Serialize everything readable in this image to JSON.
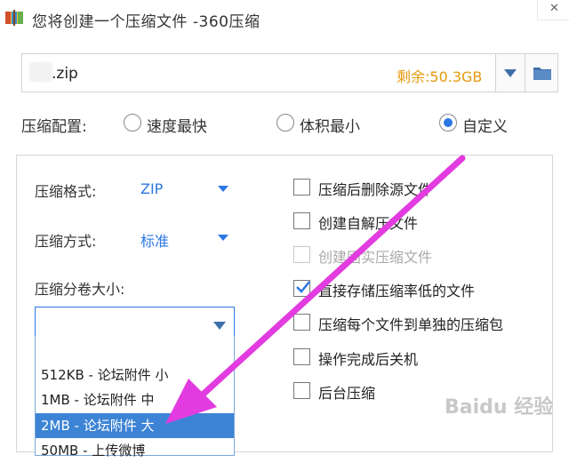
{
  "window": {
    "title": "您将创建一个压缩文件 -360压缩",
    "close_glyph": "✕"
  },
  "path": {
    "value": ".zip",
    "space_label": "剩余:50.3GB"
  },
  "config": {
    "label": "压缩配置:",
    "options": [
      {
        "label": "速度最快",
        "selected": false
      },
      {
        "label": "体积最小",
        "selected": false
      },
      {
        "label": "自定义",
        "selected": true
      }
    ]
  },
  "fields": {
    "format_label": "压缩格式:",
    "format_value": "ZIP",
    "method_label": "压缩方式:",
    "method_value": "标准",
    "split_label": "压缩分卷大小:"
  },
  "split_options": [
    {
      "label": "512KB  - 论坛附件 小",
      "selected": false
    },
    {
      "label": "1MB   - 论坛附件 中",
      "selected": false
    },
    {
      "label": "2MB   - 论坛附件 大",
      "selected": true
    },
    {
      "label": "50MB  - 上传微博",
      "selected": false
    }
  ],
  "checkboxes": [
    {
      "label": "压缩后删除源文件",
      "checked": false,
      "disabled": false
    },
    {
      "label": "创建自解压文件",
      "checked": false,
      "disabled": false
    },
    {
      "label": "创建固实压缩文件",
      "checked": false,
      "disabled": true
    },
    {
      "label": "直接存储压缩率低的文件",
      "checked": true,
      "disabled": false
    },
    {
      "label": "压缩每个文件到单独的压缩包",
      "checked": false,
      "disabled": false
    },
    {
      "label": "操作完成后关机",
      "checked": false,
      "disabled": false
    },
    {
      "label": "后台压缩",
      "checked": false,
      "disabled": false
    }
  ],
  "colors": {
    "accent": "#2b78e4",
    "space": "#e59a0f",
    "annotation_arrow": "#e23be0"
  },
  "watermark": "Baidu 经验"
}
